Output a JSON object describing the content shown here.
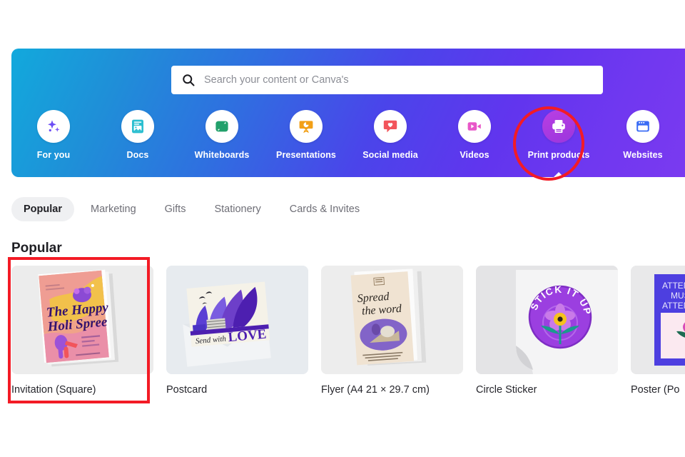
{
  "search": {
    "placeholder": "Search your content or Canva's",
    "value": "",
    "icon": "search-icon"
  },
  "nav": {
    "items": [
      {
        "label": "For you",
        "icon": "sparkles-icon",
        "color": "#6b4cf5",
        "highlighted": false
      },
      {
        "label": "Docs",
        "icon": "document-icon",
        "color": "#2bbfd0",
        "highlighted": false
      },
      {
        "label": "Whiteboards",
        "icon": "whiteboard-icon",
        "color": "#22a06b",
        "highlighted": false
      },
      {
        "label": "Presentations",
        "icon": "presentation-icon",
        "color": "#f2a017",
        "highlighted": false
      },
      {
        "label": "Social media",
        "icon": "heart-bubble-icon",
        "color": "#f2545b",
        "highlighted": false
      },
      {
        "label": "Videos",
        "icon": "video-camera-icon",
        "color": "#e857c8",
        "highlighted": false
      },
      {
        "label": "Print products",
        "icon": "printer-icon",
        "color": "#ffffff",
        "highlighted": true
      },
      {
        "label": "Websites",
        "icon": "browser-icon",
        "color": "#3b6df5",
        "highlighted": false
      }
    ],
    "active_index": 6,
    "annotation_color": "#f31b25"
  },
  "tabs": {
    "items": [
      {
        "label": "Popular",
        "active": true
      },
      {
        "label": "Marketing",
        "active": false
      },
      {
        "label": "Gifts",
        "active": false
      },
      {
        "label": "Stationery",
        "active": false
      },
      {
        "label": "Cards & Invites",
        "active": false
      }
    ]
  },
  "section": {
    "title": "Popular"
  },
  "cards": {
    "selection_color": "#f31b25",
    "selected_index": 0,
    "items": [
      {
        "label": "Invitation (Square)",
        "selected": true,
        "art": {
          "line1": "The Happy",
          "line2": "Holi Spree"
        }
      },
      {
        "label": "Postcard",
        "selected": false,
        "art": {
          "line1": "Send with",
          "line2": "LOVE"
        }
      },
      {
        "label": "Flyer (A4 21 × 29.7 cm)",
        "selected": false,
        "art": {
          "line1": "Spread",
          "line2": "the word"
        }
      },
      {
        "label": "Circle Sticker",
        "selected": false,
        "art": {
          "line1": "STICK IT UP",
          "line2": ""
        }
      },
      {
        "label": "Poster (Po",
        "selected": false,
        "art": {
          "line1": "AT",
          "line2": "ATT"
        }
      }
    ]
  }
}
